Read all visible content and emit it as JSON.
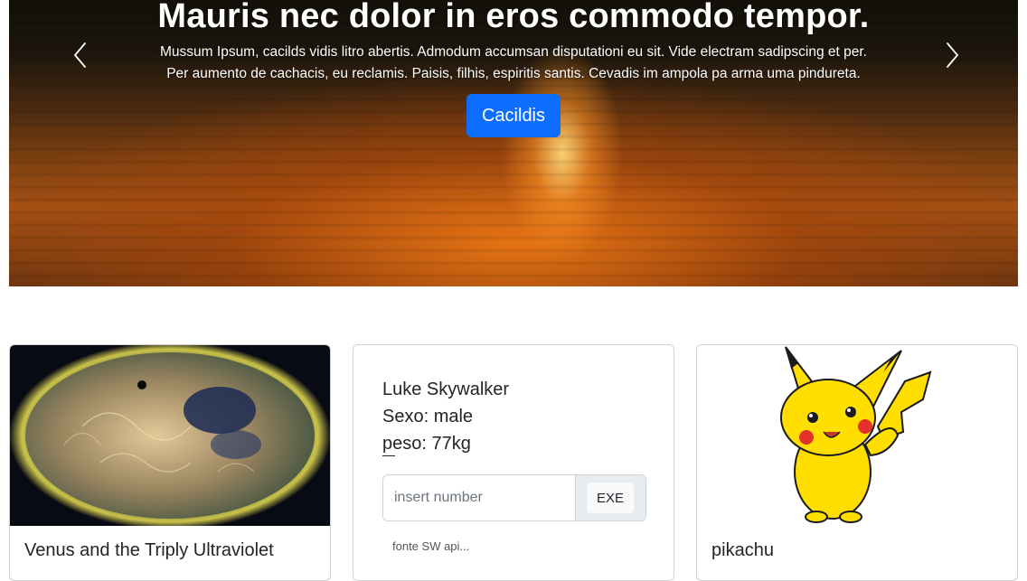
{
  "carousel": {
    "title": "Mauris nec dolor in eros commodo tempor.",
    "text": "Mussum Ipsum, cacilds vidis litro abertis. Admodum accumsan disputationi eu sit. Vide electram sadipscing et per. Per aumento de cachacis, eu reclamis. Paisis, filhis, espiritis santis. Cevadis im ampola pa arma uma pindureta.",
    "button_label": "Cacildis",
    "prev_icon": "chevron-left-icon",
    "next_icon": "chevron-right-icon"
  },
  "cards": {
    "nasa": {
      "title": "Venus and the Triply Ultraviolet"
    },
    "character": {
      "name": "Luke Skywalker",
      "gender": "Sexo: male",
      "weight": "peso: 77kg",
      "input_placeholder": "insert number",
      "button_label": "EXE",
      "source": "fonte SW api..."
    },
    "pokemon": {
      "title": "pikachu"
    }
  },
  "colors": {
    "primary": "#0d6efd",
    "border": "#ced4da",
    "pikachu": "#ffde00"
  }
}
